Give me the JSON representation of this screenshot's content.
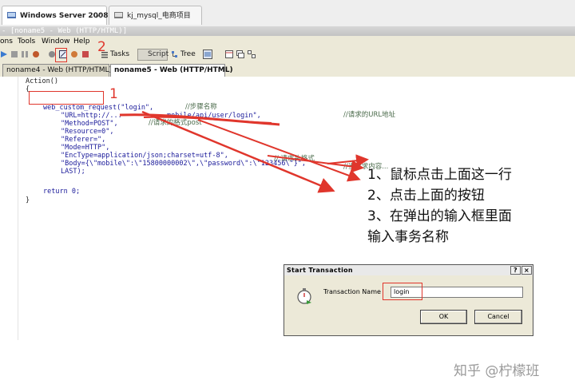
{
  "vm_tabs": [
    {
      "label": "Windows Server 2008 x64",
      "close": "×"
    },
    {
      "label": "kj_mysql_电商项目",
      "close": ""
    }
  ],
  "window_title": "- [noname5 - Web (HTTP/HTML)]",
  "menu": [
    "ons",
    "Tools",
    "Window",
    "Help"
  ],
  "toolbar": {
    "tasks_label": "Tasks",
    "script_label": "Script",
    "tree_label": "Tree"
  },
  "doc_tabs": [
    "noname4 - Web (HTTP/HTML)",
    "noname5 - Web (HTTP/HTML)"
  ],
  "code": {
    "line_action": "Action()",
    "line_open": "{",
    "line_req": "web_custom_request(\"login\",",
    "line_req_comment": "//步骤名称",
    "line_url": "\"URL=http://...        ...mobile/api/user/login\",",
    "line_url_comment": "//请求的URL地址",
    "line_method": "\"Method=POST\",",
    "line_method_comment": "//请求的格式post",
    "line_resource": "\"Resource=0\",",
    "line_referer": "\"Referer=\",",
    "line_mode": "\"Mode=HTTP\",",
    "line_enctype": "\"EncType=application/json;charset=utf-8\",",
    "line_enctype_comment": "// 请求头格式",
    "line_body": "\"Body={\\\"mobile\\\":\\\"15800000002\\\",\\\"password\\\":\\\"123456\\\"}\",",
    "line_body_comment": "//当请求内容...",
    "line_last": "LAST);",
    "line_return": "return 0;",
    "line_close": "}"
  },
  "annotations": {
    "num1": "1",
    "num2": "2",
    "num3": "3",
    "step1": "1、鼠标点击上面这一行",
    "step2": "2、点击上面的按钮",
    "step3": "3、在弹出的输入框里面",
    "step4": "输入事务名称"
  },
  "dialog": {
    "title": "Start Transaction",
    "help_btn": "?",
    "close_btn": "×",
    "field_label": "Transaction Name",
    "field_value": "login",
    "ok_label": "OK",
    "cancel_label": "Cancel"
  },
  "watermark": "知乎 @柠檬班",
  "colors": {
    "annotation": "#e0362c",
    "code_blue": "#1a1a9a"
  }
}
